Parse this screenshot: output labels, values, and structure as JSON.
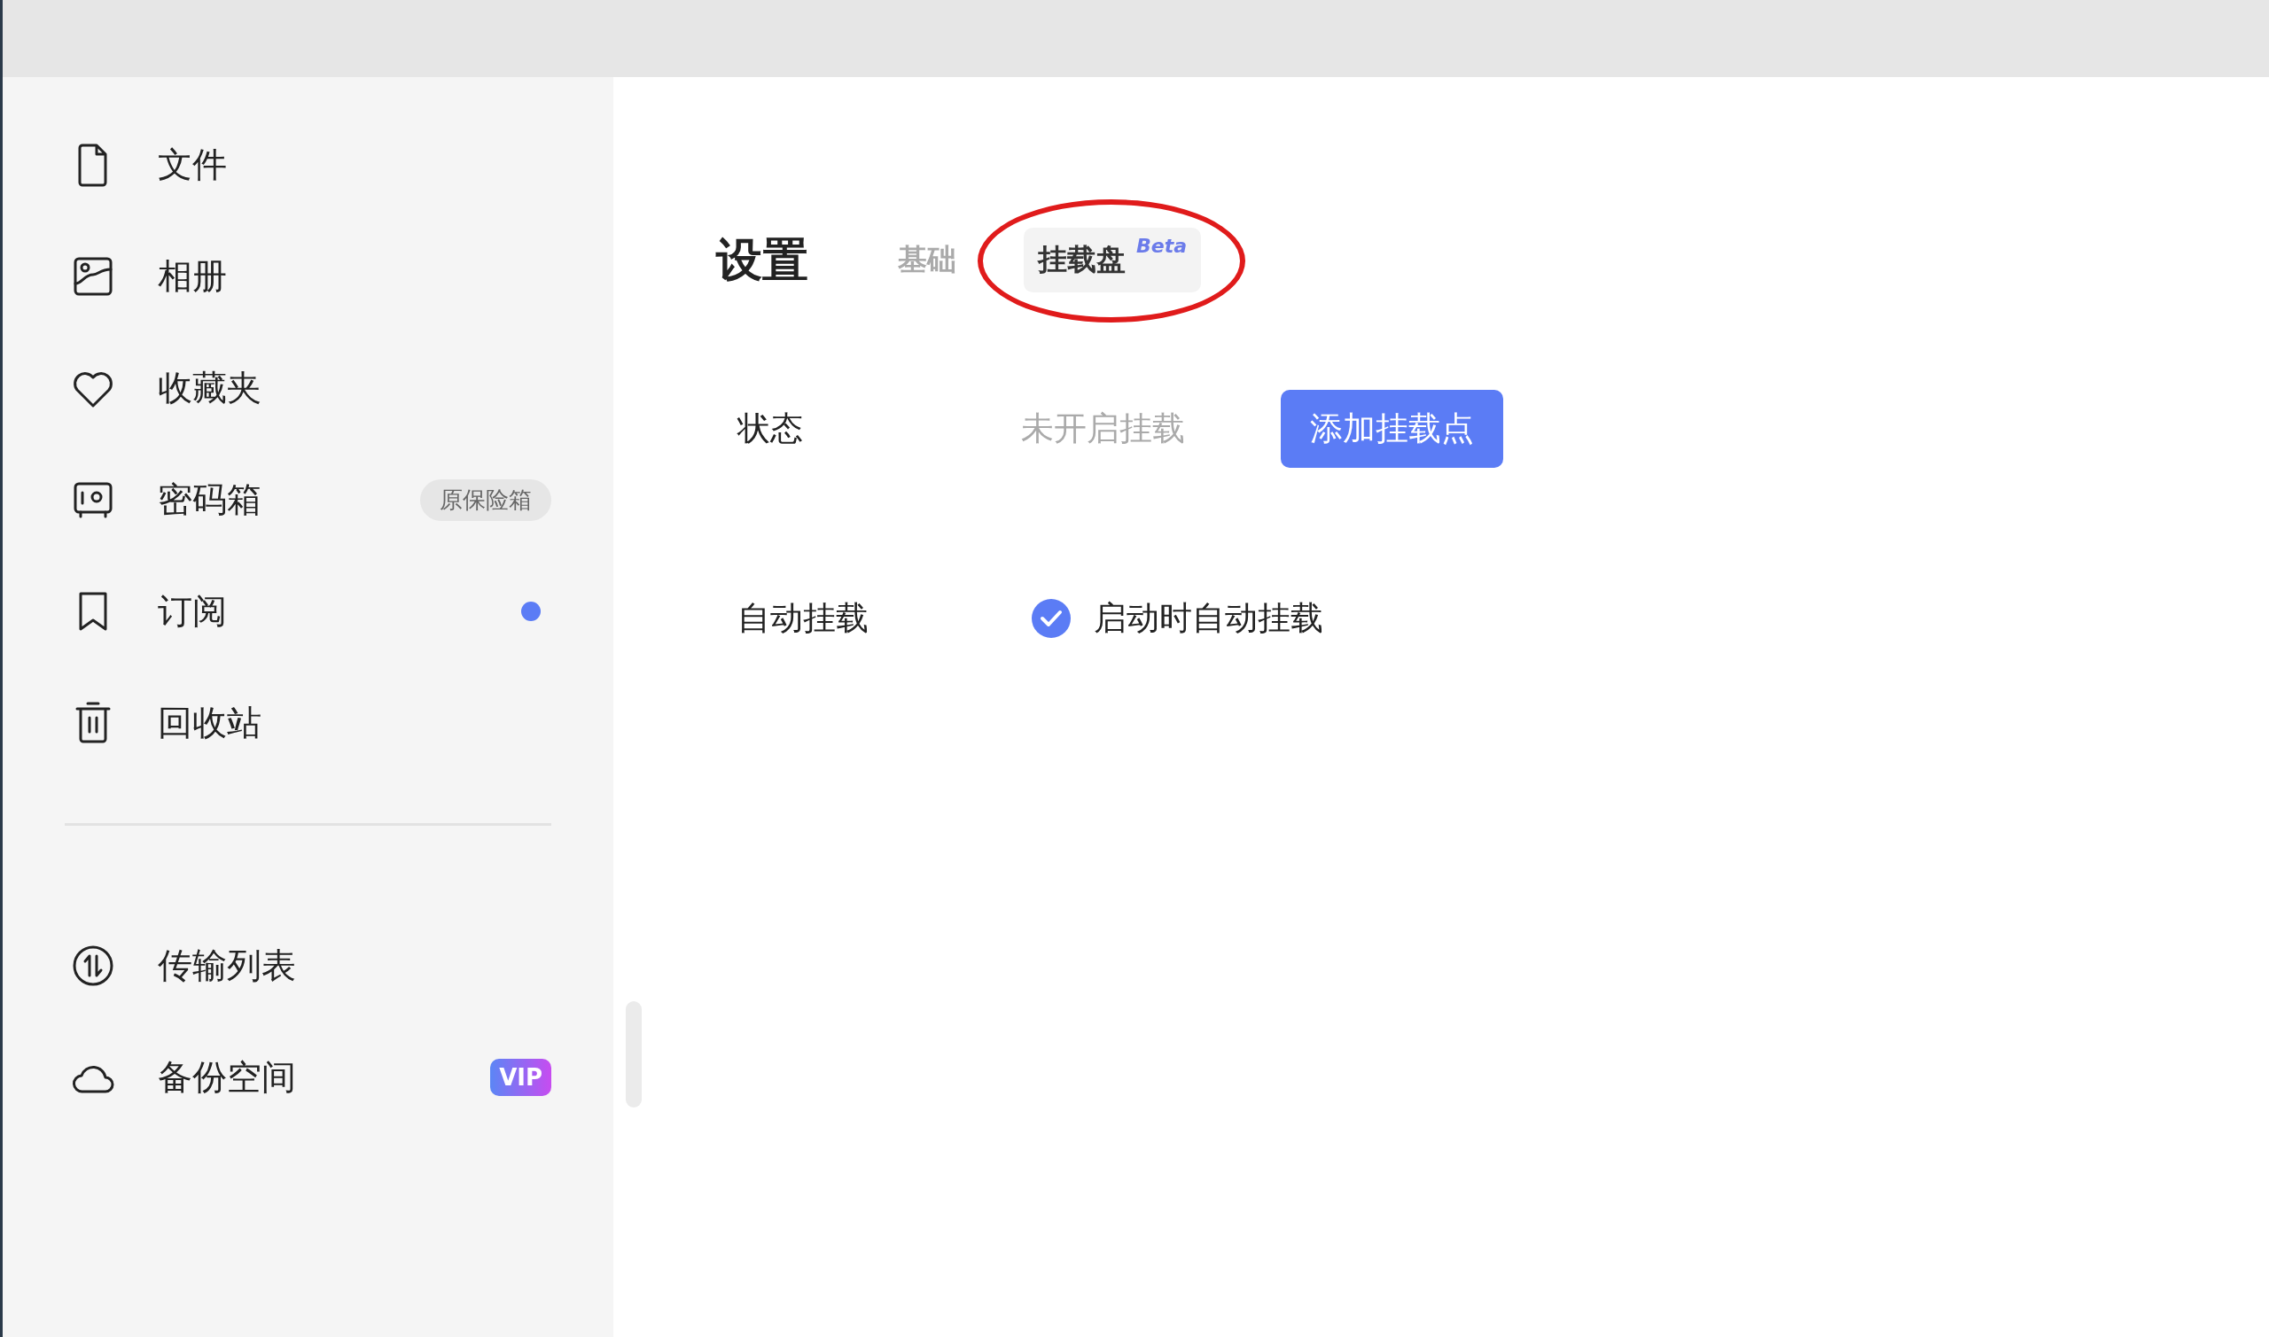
{
  "sidebar": {
    "items": [
      {
        "label": "文件",
        "selected": false
      },
      {
        "label": "相册",
        "selected": false
      },
      {
        "label": "收藏夹",
        "selected": false
      },
      {
        "label": "密码箱",
        "selected": false,
        "badge": "原保险箱"
      },
      {
        "label": "订阅",
        "selected": false,
        "dot": true
      },
      {
        "label": "回收站",
        "selected": false
      }
    ],
    "bottom_items": [
      {
        "label": "传输列表",
        "selected": false
      },
      {
        "label": "备份空间",
        "selected": false,
        "vip": "VIP"
      }
    ]
  },
  "settings": {
    "title": "设置",
    "tabs": [
      {
        "label": "基础",
        "selected": false,
        "circled": false
      },
      {
        "label": "挂载盘",
        "selected": true,
        "circled": true,
        "tag": "Beta"
      }
    ],
    "rows": [
      {
        "kind": "status",
        "label": "状态",
        "value": "未开启挂载",
        "button": "添加挂载点"
      },
      {
        "kind": "checkbox",
        "label": "自动挂载",
        "option": "启动时自动挂载",
        "checked": true
      }
    ]
  }
}
